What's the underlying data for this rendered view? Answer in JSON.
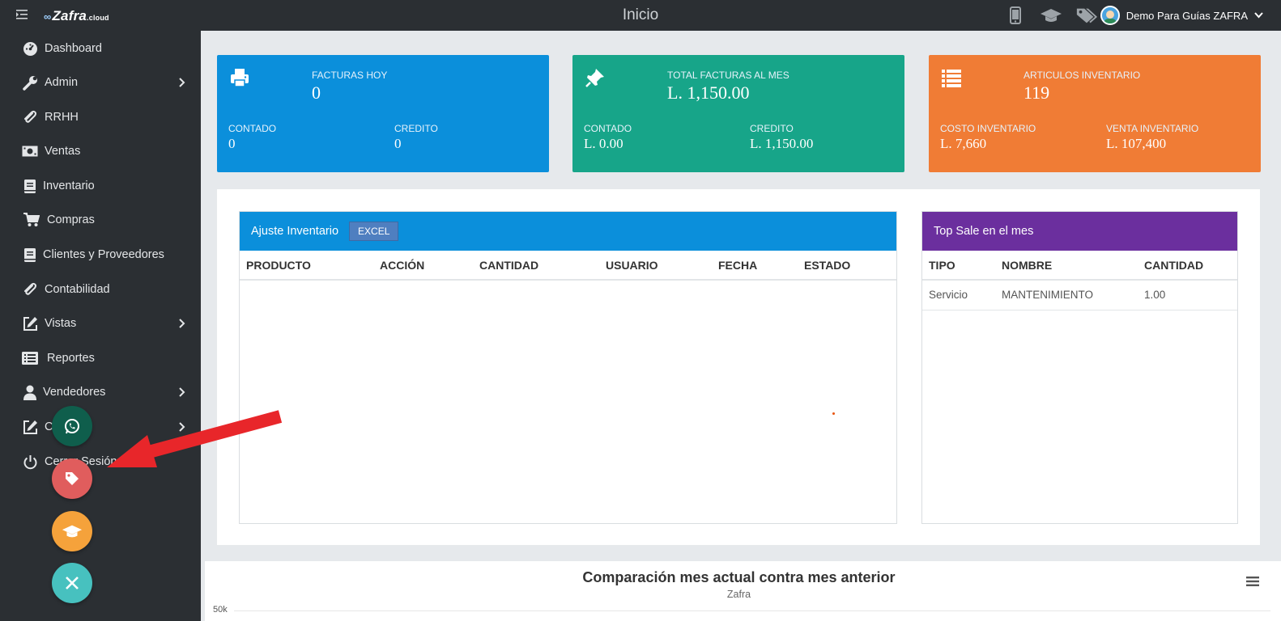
{
  "app": {
    "brand": "Zafra",
    "brand_suffix": ".cloud",
    "page_title": "Inicio"
  },
  "header": {
    "user_name": "Demo Para Guías ZAFRA"
  },
  "sidebar": {
    "items": [
      {
        "label": "Dashboard",
        "icon": "dashboard-icon",
        "has_submenu": false
      },
      {
        "label": "Admin",
        "icon": "wrench-icon",
        "has_submenu": true
      },
      {
        "label": "RRHH",
        "icon": "paperclip-icon",
        "has_submenu": false
      },
      {
        "label": "Ventas",
        "icon": "money-icon",
        "has_submenu": false
      },
      {
        "label": "Inventario",
        "icon": "book-icon",
        "has_submenu": false
      },
      {
        "label": "Compras",
        "icon": "cart-icon",
        "has_submenu": false
      },
      {
        "label": "Clientes y Proveedores",
        "icon": "book-icon",
        "has_submenu": false
      },
      {
        "label": "Contabilidad",
        "icon": "paperclip-icon",
        "has_submenu": false
      },
      {
        "label": "Vistas",
        "icon": "edit-icon",
        "has_submenu": true
      },
      {
        "label": "Reportes",
        "icon": "list-icon",
        "has_submenu": false
      },
      {
        "label": "Vendedores",
        "icon": "user-icon",
        "has_submenu": true
      },
      {
        "label": "Co...s",
        "icon": "edit-icon",
        "has_submenu": true
      },
      {
        "label": "Cerrar Sesión",
        "icon": "power-icon",
        "has_submenu": false
      }
    ]
  },
  "cards": [
    {
      "title": "FACTURAS HOY",
      "value": "0",
      "left_label": "CONTADO",
      "left_value": "0",
      "right_label": "CREDITO",
      "right_value": "0",
      "color": "#0b8fdb"
    },
    {
      "title": "TOTAL FACTURAS AL MES",
      "value": "L. 1,150.00",
      "left_label": "CONTADO",
      "left_value": "L. 0.00",
      "right_label": "CREDITO",
      "right_value": "L. 1,150.00",
      "color": "#17a589"
    },
    {
      "title": "ARTICULOS INVENTARIO",
      "value": "119",
      "left_label": "COSTO INVENTARIO",
      "left_value": "L. 7,660",
      "right_label": "VENTA INVENTARIO",
      "right_value": "L. 107,400",
      "color": "#f07c35"
    }
  ],
  "ajuste": {
    "title": "Ajuste Inventario",
    "excel_label": "EXCEL",
    "columns": [
      "PRODUCTO",
      "ACCIÓN",
      "CANTIDAD",
      "USUARIO",
      "FECHA",
      "ESTADO"
    ]
  },
  "top_sale": {
    "title": "Top Sale en el mes",
    "columns": [
      "TIPO",
      "NOMBRE",
      "CANTIDAD"
    ],
    "rows": [
      [
        "Servicio",
        "MANTENIMIENTO",
        "1.00"
      ]
    ]
  },
  "chart": {
    "title": "Comparación mes actual contra mes anterior",
    "subtitle": "Zafra",
    "y_tick_top": "50k"
  },
  "colors": {
    "sidebar": "#2b2f33",
    "ajuste_header": "#0b8fdb",
    "top_sale_header": "#6b2f9e",
    "fab_whatsapp": "#0f5e4c",
    "fab_tag": "#e05d5d",
    "fab_grad": "#f5a23b",
    "fab_close": "#47c1bf",
    "arrow": "#e8262a"
  }
}
